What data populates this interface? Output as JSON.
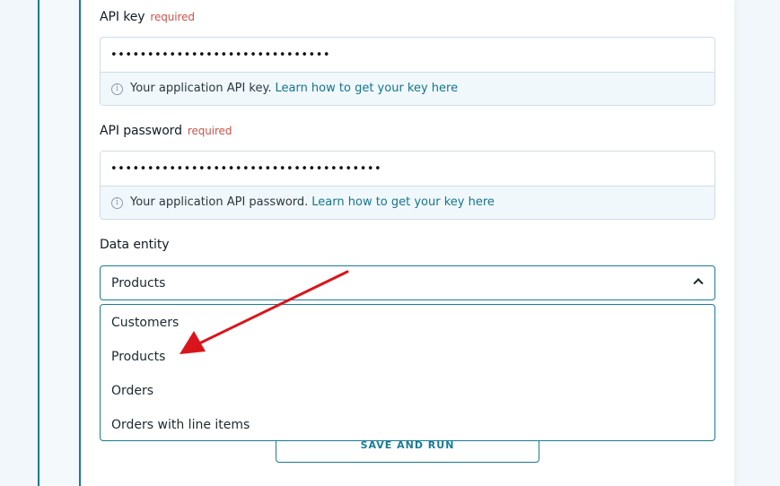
{
  "api_key": {
    "label": "API key",
    "required": "required",
    "value": "••••••••••••••••••••••••••••••",
    "hint": "Your application API key.",
    "link": "Learn how to get your key here"
  },
  "api_password": {
    "label": "API password",
    "required": "required",
    "value": "•••••••••••••••••••••••••••••••••••••",
    "hint": "Your application API password.",
    "link": "Learn how to get your key here"
  },
  "data_entity": {
    "label": "Data entity",
    "selected": "Products",
    "options": [
      "Customers",
      "Products",
      "Orders",
      "Orders with line items"
    ]
  },
  "save_button": "SAVE AND RUN",
  "colors": {
    "accent": "#1a7b96",
    "required": "#c9544a",
    "arrow": "#d9151b"
  },
  "icons": [
    "info-icon",
    "chevron-up-icon",
    "annotation-arrow"
  ]
}
